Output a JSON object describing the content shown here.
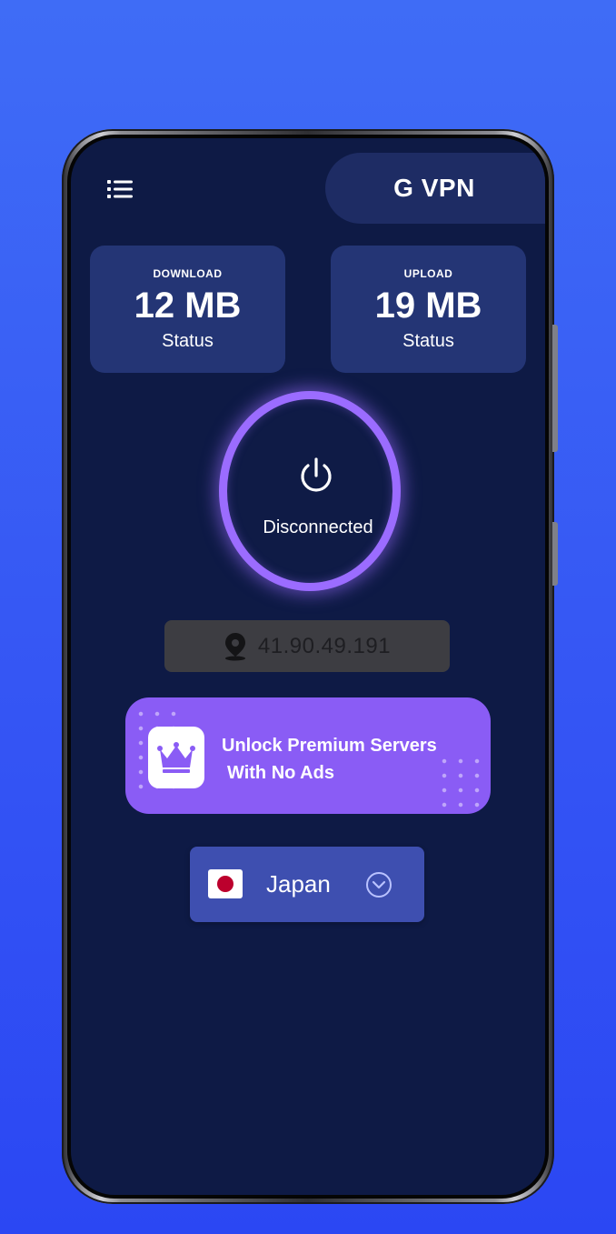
{
  "app": {
    "title": "G VPN"
  },
  "stats": {
    "download": {
      "label": "DOWNLOAD",
      "value": "12 MB",
      "sub": "Status"
    },
    "upload": {
      "label": "UPLOAD",
      "value": "19 MB",
      "sub": "Status"
    }
  },
  "connection": {
    "status": "Disconnected",
    "ip": "41.90.49.191"
  },
  "premium": {
    "line1": "Unlock Premium Servers",
    "line2": "With No Ads"
  },
  "server": {
    "country": "Japan"
  },
  "icons": {
    "menu": "list-icon",
    "power": "power-icon",
    "location": "location-pin-icon",
    "premium": "crown-icon",
    "flag": "japan-flag-icon",
    "dropdown": "chevron-down-circle-icon"
  },
  "colors": {
    "background": "#3556f4",
    "screen": "#0e1a45",
    "card": "#243575",
    "accent": "#9b6cff",
    "banner": "#8a5cf5",
    "selector": "#3e4fb0"
  }
}
